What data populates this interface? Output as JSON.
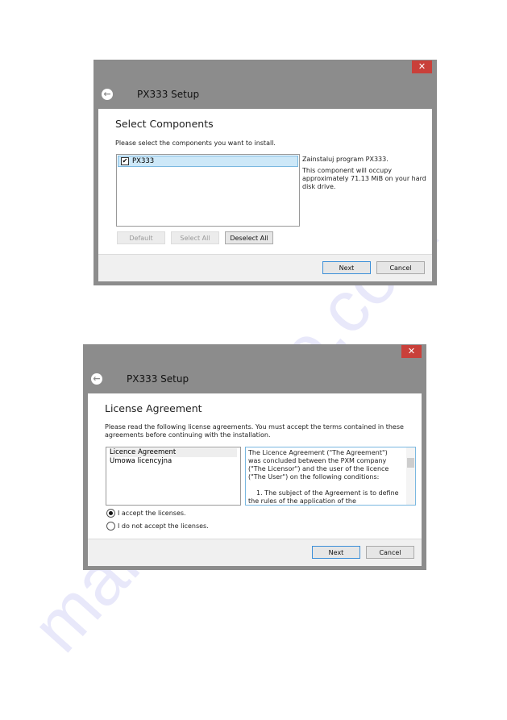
{
  "watermark": "manualshive.com",
  "dialog1": {
    "title": "PX333 Setup",
    "close": "✕",
    "heading": "Select Components",
    "instruction": "Please select the components you want to install.",
    "components": [
      {
        "label": "PX333",
        "checked": true
      }
    ],
    "description": "Zainstaluj program PX333.",
    "space": "This component will occupy approximately 71.13 MiB on your hard disk drive.",
    "buttons": {
      "default": "Default",
      "select_all": "Select All",
      "deselect_all": "Deselect All",
      "next": "Next",
      "cancel": "Cancel"
    }
  },
  "dialog2": {
    "title": "PX333 Setup",
    "close": "✕",
    "heading": "License Agreement",
    "instruction": "Please read the following license agreements. You must accept the terms contained in these agreements before continuing with the installation.",
    "licenses": [
      "Licence Agreement",
      "Umowa licencyjna"
    ],
    "license_text": "The Licence Agreement (\"The Agreement\") was concluded between the PXM company (\"The Licensor\") and the user of the licence (\"The User\") on the following conditions:",
    "license_text2": "1. The subject of the Agreement is to define the rules of the application of the",
    "accept": "I accept the licenses.",
    "decline": "I do not accept the licenses.",
    "accepted": true,
    "buttons": {
      "next": "Next",
      "cancel": "Cancel"
    }
  }
}
